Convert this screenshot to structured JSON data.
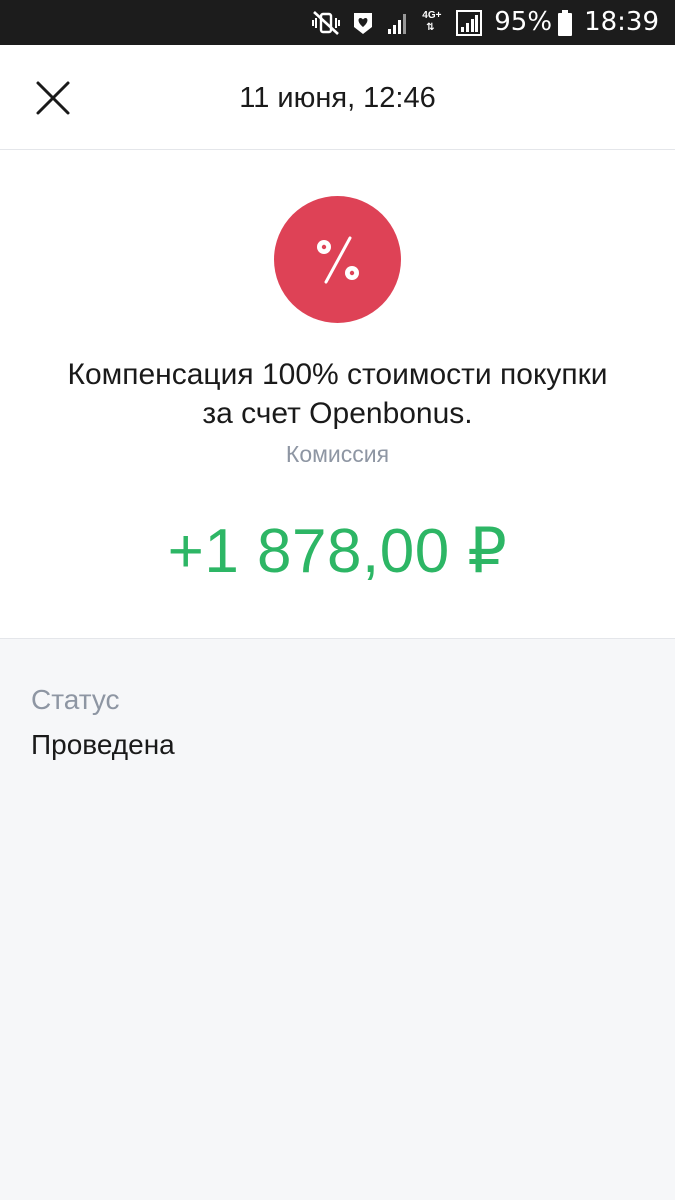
{
  "status_bar": {
    "network": "4G+",
    "network_arrows": "⇅",
    "battery": "95%",
    "time": "18:39",
    "icons": [
      "mute-vibrate-icon",
      "shield-heart-icon",
      "signal-icon",
      "network-4g-icon",
      "signal-icon",
      "battery-icon"
    ]
  },
  "header": {
    "title": "11 июня, 12:46",
    "close_icon": "close-icon"
  },
  "transaction": {
    "icon": "percent-icon",
    "icon_color": "#de4256",
    "description": "Компенсация 100% стоимости покупки за счет Openbonus.",
    "category": "Комиссия",
    "amount": "+1 878,00 ₽",
    "amount_color": "#2db665"
  },
  "details": {
    "status_label": "Статус",
    "status_value": "Проведена"
  }
}
